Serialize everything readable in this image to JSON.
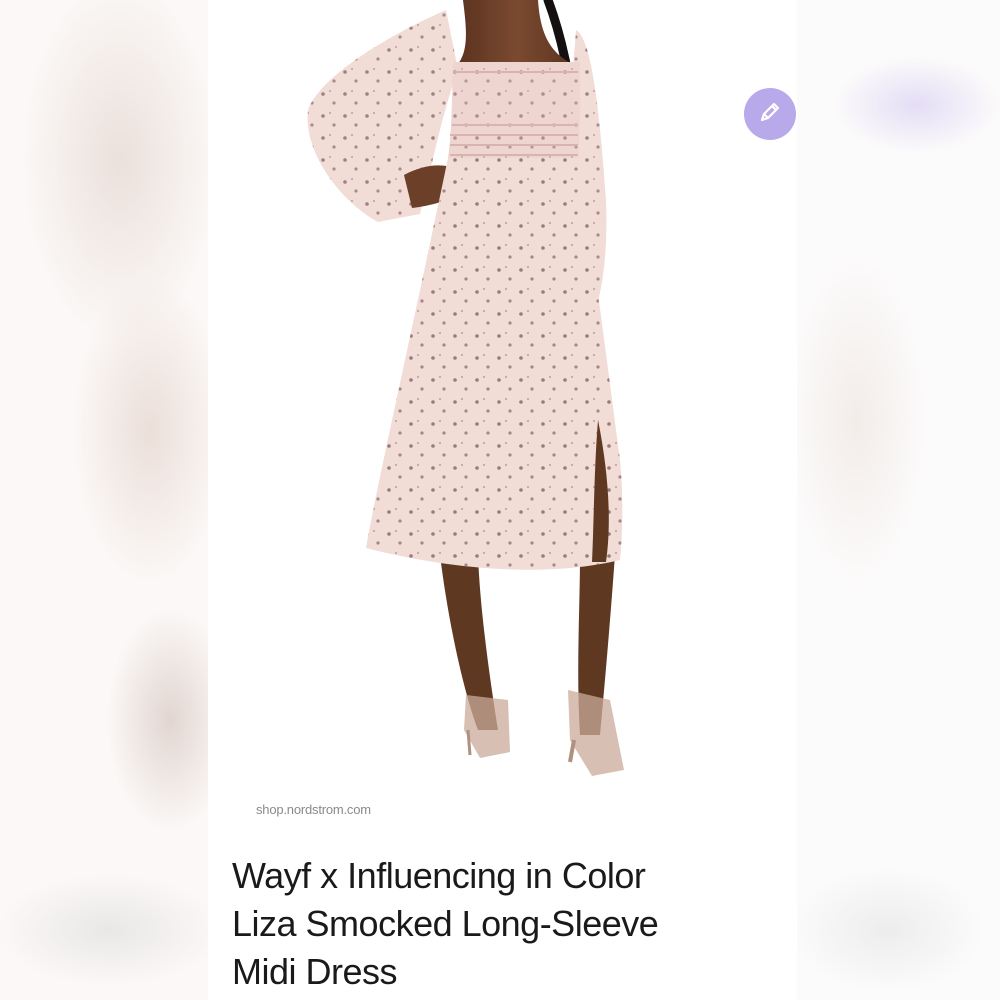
{
  "source": {
    "domain": "shop.nordstrom.com"
  },
  "product": {
    "title_lines": [
      "Wayf x Influencing in Color",
      "Liza Smocked Long-Sleeve",
      "Midi Dress"
    ]
  },
  "icons": {
    "edit": "pencil-icon"
  },
  "colors": {
    "edit_button": "#b8a9ea",
    "title_text": "#1a1a1a",
    "domain_text": "#8a8a8a",
    "dress": "#f1dcd6",
    "skin": "#6b3f28"
  }
}
